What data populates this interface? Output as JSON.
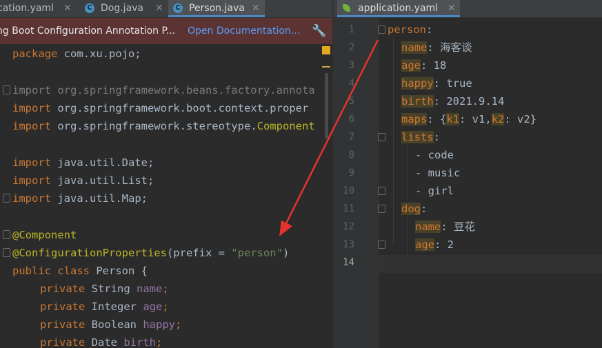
{
  "left_tabs": [
    {
      "label": "cation.yaml",
      "close": "✕"
    },
    {
      "label": "Dog.java",
      "icon": "C",
      "close": "✕"
    },
    {
      "label": "Person.java",
      "icon": "C",
      "close": "✕",
      "active": true
    }
  ],
  "right_tab": {
    "label": "application.yaml",
    "close": "✕"
  },
  "banner": {
    "message": "ng Boot Configuration Annotation P...",
    "link": "Open Documentation..."
  },
  "java": {
    "package_kw": "package",
    "package_name": " com.xu.pojo;",
    "import_kw": "import",
    "import1": " org.springframework.beans.factory.annota",
    "import2": " org.springframework.boot.context.proper",
    "import3_pre": " org.springframework.stereotype.",
    "import3_cls": "Component",
    "import4": " java.util.Date;",
    "import5": " java.util.List;",
    "import6": " java.util.Map;",
    "ann1": "@Component",
    "ann2": "@ConfigurationProperties",
    "ann2_paren": "(prefix = ",
    "ann2_str": "\"person\"",
    "ann2_close": ")",
    "class_kw": "public class",
    "class_name": " Person {",
    "private_kw": "private",
    "fields": [
      {
        "type": " String ",
        "name": "name",
        "semi": ";"
      },
      {
        "type": " Integer ",
        "name": "age",
        "semi": ";"
      },
      {
        "type": " Boolean ",
        "name": "happy",
        "semi": ";"
      },
      {
        "type": " Date ",
        "name": "birth",
        "semi": ";"
      }
    ]
  },
  "yaml": {
    "line_numbers": [
      "1",
      "2",
      "3",
      "4",
      "5",
      "6",
      "7",
      "8",
      "9",
      "10",
      "11",
      "12",
      "13",
      "14"
    ],
    "person_key": "person",
    "colon": ":",
    "name_key": "name",
    "name_val": " 海客谈",
    "age_key": "age",
    "age_val": " 18",
    "happy_key": "happy",
    "happy_val": " true",
    "birth_key": "birth",
    "birth_val": " 2021.9.14",
    "maps_key": "maps",
    "maps_open": " {",
    "k1": "k1",
    "v1": ": v1,",
    "k2": "k2",
    "v2": ": v2}",
    "lists_key": "lists",
    "list_items": [
      "- code",
      "- music",
      "- girl"
    ],
    "dog_key": "dog",
    "dog_name_key": "name",
    "dog_name_val": " 豆花",
    "dog_age_key": "age",
    "dog_age_val": " 2"
  },
  "colors": {
    "arrow": "#e8322f",
    "keyword": "#cc7832",
    "annotation": "#bbb529",
    "string": "#6a8759",
    "field": "#9876aa"
  }
}
